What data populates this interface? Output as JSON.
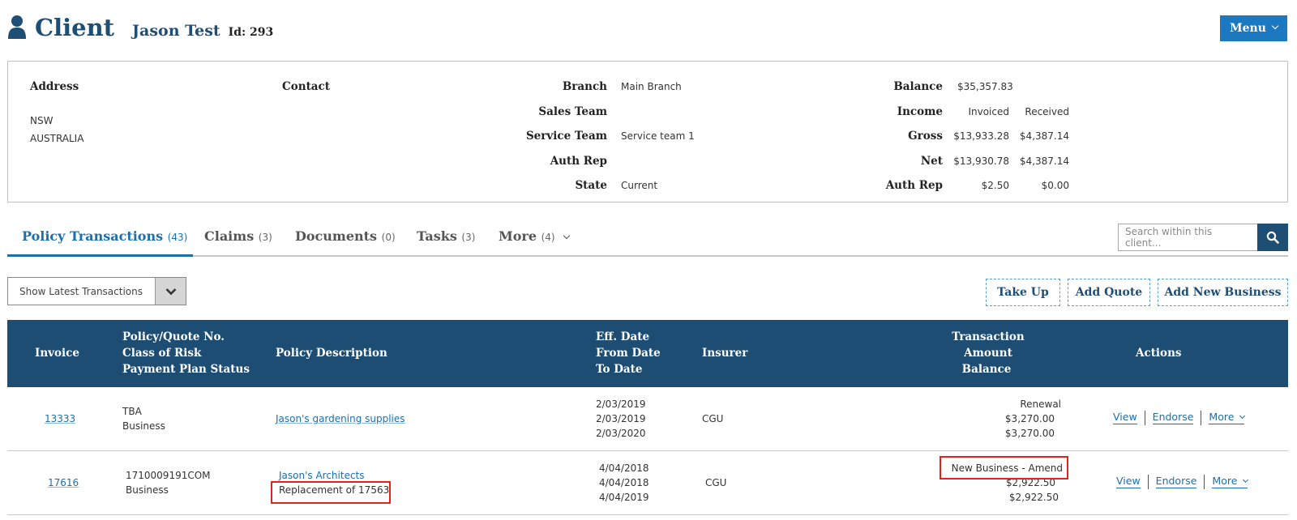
{
  "header": {
    "title": "Client",
    "client_name": "Jason Test",
    "client_id": "Id: 293",
    "menu_label": "Menu"
  },
  "summary": {
    "address_label": "Address",
    "address_lines": [
      "NSW",
      "AUSTRALIA"
    ],
    "contact_label": "Contact",
    "branch_label": "Branch",
    "branch_value": "Main Branch",
    "sales_team_label": "Sales Team",
    "sales_team_value": "",
    "service_team_label": "Service Team",
    "service_team_value": "Service team 1",
    "auth_rep_label": "Auth Rep",
    "auth_rep_value": "",
    "state_label": "State",
    "state_value": "Current",
    "balance_label": "Balance",
    "balance_value": "$35,357.83",
    "income_label": "Income",
    "invoiced_label": "Invoiced",
    "received_label": "Received",
    "gross_label": "Gross",
    "gross_invoiced": "$13,933.28",
    "gross_received": "$4,387.14",
    "net_label": "Net",
    "net_invoiced": "$13,930.78",
    "net_received": "$4,387.14",
    "authrep_fin_label": "Auth Rep",
    "authrep_invoiced": "$2.50",
    "authrep_received": "$0.00"
  },
  "tabs": [
    {
      "label": "Policy Transactions",
      "count": "(43)"
    },
    {
      "label": "Claims",
      "count": "(3)"
    },
    {
      "label": "Documents",
      "count": "(0)"
    },
    {
      "label": "Tasks",
      "count": "(3)"
    },
    {
      "label": "More",
      "count": "(4)"
    }
  ],
  "search": {
    "placeholder": "Search within this client..."
  },
  "filter": {
    "selected": "Show Latest Transactions"
  },
  "actions": {
    "take_up": "Take Up",
    "add_quote": "Add Quote",
    "add_new_business": "Add New Business"
  },
  "table": {
    "headers": {
      "invoice": "Invoice",
      "policy": [
        "Policy/Quote No.",
        "Class of Risk",
        "Payment Plan Status"
      ],
      "description": "Policy Description",
      "dates": [
        "Eff. Date",
        "From Date",
        "To Date"
      ],
      "insurer": "Insurer",
      "transaction": [
        "Transaction",
        "Amount",
        "Balance"
      ],
      "actions": "Actions"
    },
    "rows": [
      {
        "invoice": "13333",
        "policy_no": "TBA",
        "class_of_risk": "Business",
        "description": "Jason's gardening supplies",
        "description_note": "",
        "eff_date": "2/03/2019",
        "from_date": "2/03/2019",
        "to_date": "2/03/2020",
        "insurer": "CGU",
        "transaction": "Renewal",
        "amount": "$3,270.00",
        "balance": "$3,270.00",
        "view": "View",
        "endorse": "Endorse",
        "more": "More"
      },
      {
        "invoice": "17616",
        "policy_no": "1710009191COM",
        "class_of_risk": "Business",
        "description": "Jason's Architects",
        "description_note": "Replacement of 17563",
        "eff_date": "4/04/2018",
        "from_date": "4/04/2018",
        "to_date": "4/04/2019",
        "insurer": "CGU",
        "transaction": "New Business - Amend",
        "amount": "$2,922.50",
        "balance": "$2,922.50",
        "view": "View",
        "endorse": "Endorse",
        "more": "More"
      }
    ]
  },
  "colors": {
    "primary_dark": "#1d4d72",
    "accent_blue": "#1c78c0",
    "link": "#1c6fae",
    "highlight_red": "#e0241c"
  }
}
